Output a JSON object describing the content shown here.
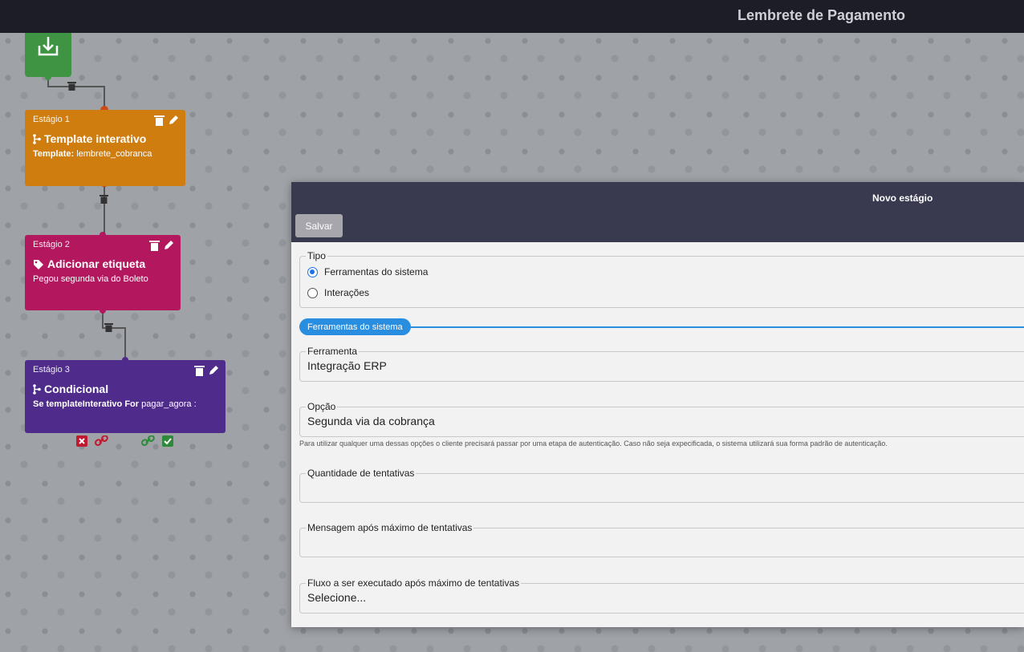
{
  "topbar": {
    "title": "Lembrete de Pagamento"
  },
  "flow": {
    "start": {
      "icon": "download-icon",
      "color": "#3e9443"
    },
    "nodes": [
      {
        "stage": "Estágio 1",
        "title": "Template interativo",
        "icon": "branch-icon",
        "desc_label": "Template:",
        "desc_value": "lembrete_cobranca",
        "color": "#cf7d0f"
      },
      {
        "stage": "Estágio 2",
        "title": "Adicionar etiqueta",
        "icon": "tag-icon",
        "desc_value": "Pegou segunda via do Boleto",
        "color": "#b3185f"
      },
      {
        "stage": "Estágio 3",
        "title": "Condicional",
        "icon": "branch-icon",
        "desc_prefix": "Se templateInterativo",
        "desc_for": "For",
        "desc_suffix": "pagar_agora :",
        "color": "#4f2c8b"
      }
    ]
  },
  "modal": {
    "title": "Novo estágio",
    "save_label": "Salvar",
    "tipo": {
      "legend": "Tipo",
      "options": [
        {
          "label": "Ferramentas do sistema",
          "checked": true
        },
        {
          "label": "Interações",
          "checked": false
        }
      ]
    },
    "section_label": "Ferramentas do sistema",
    "ferramenta": {
      "legend": "Ferramenta",
      "value": "Integração ERP"
    },
    "opcao": {
      "legend": "Opção",
      "value": "Segunda via da cobrança"
    },
    "hint": "Para utilizar qualquer uma dessas opções o cliente precisará passar por uma etapa de autenticação. Caso não seja expecificada, o sistema utilizará sua forma padrão de autenticação.",
    "quantidade": {
      "legend": "Quantidade de tentativas",
      "value": ""
    },
    "mensagem": {
      "legend": "Mensagem após máximo de tentativas",
      "value": ""
    },
    "fluxo": {
      "legend": "Fluxo a ser executado após máximo de tentativas",
      "value": "Selecione..."
    }
  },
  "colors": {
    "accent": "#2a8ee0",
    "header": "#393a4f",
    "topbar": "#1d1d27"
  }
}
